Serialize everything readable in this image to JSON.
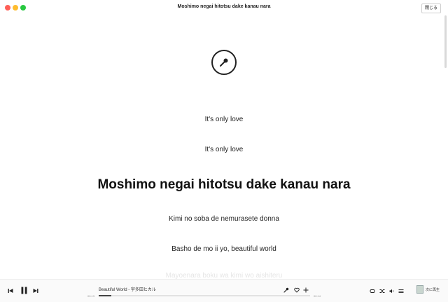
{
  "window": {
    "title": "Moshimo negai hitotsu dake kanau nara",
    "close_label": "閉じる"
  },
  "icons": {
    "mic": "microphone-icon"
  },
  "lyrics": [
    {
      "text": "It's only love",
      "style": "normal"
    },
    {
      "text": "It's only love",
      "style": "normal"
    },
    {
      "text": "Moshimo negai hitotsu dake kanau nara",
      "style": "current"
    },
    {
      "text": "Kimi no soba de nemurasete donna",
      "style": "normal"
    },
    {
      "text": "Basho de mo ii yo, beautiful world",
      "style": "normal"
    },
    {
      "text": "Mayoenara boku wa kimi wo aishiteru",
      "style": "faded"
    }
  ],
  "player": {
    "track": "Beautiful World - 宇多田ヒカル",
    "elapsed": "00:13",
    "remaining": "00:14",
    "progress": 0.06,
    "queue_label": "次に再生",
    "accent": "#444444"
  }
}
